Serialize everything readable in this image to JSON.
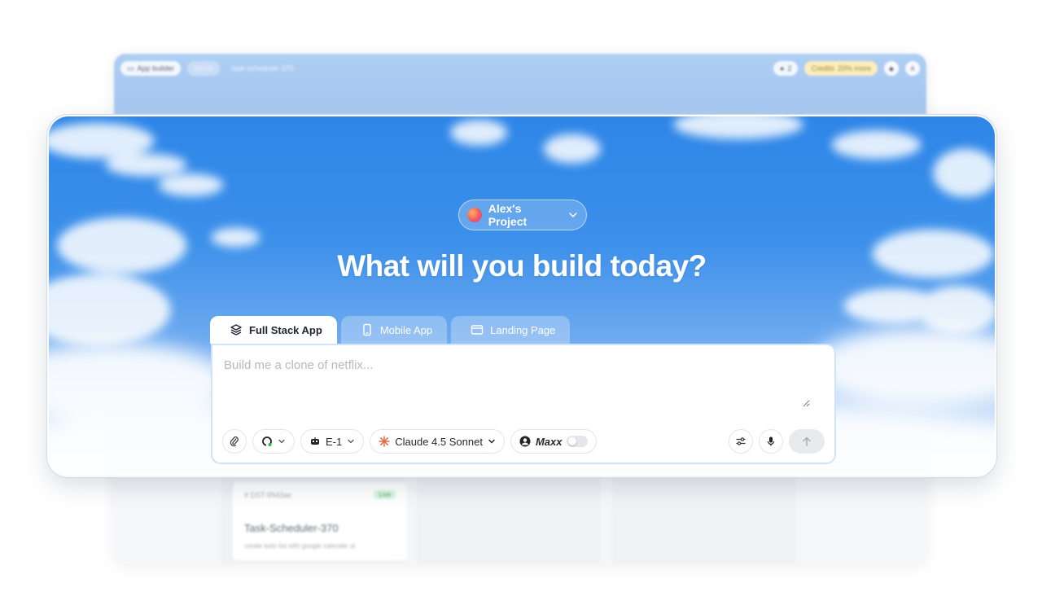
{
  "background_window": {
    "app_builder_label": "App builder",
    "home_label": "Home",
    "crumb": "task-scheduler-370",
    "count": "2",
    "credits_label": "Credits",
    "credits_badge": "20% more",
    "avatar": "A",
    "card": {
      "id": "# DST-9943ae",
      "status": "Live",
      "title": "Task-Scheduler-370",
      "description": "create todo list with google calendar ui"
    }
  },
  "project": {
    "name": "Alex's Project"
  },
  "headline": "What will you build today?",
  "tabs": [
    {
      "label": "Full Stack App",
      "icon": "layers-icon",
      "active": true
    },
    {
      "label": "Mobile App",
      "icon": "mobile-icon",
      "active": false
    },
    {
      "label": "Landing Page",
      "icon": "browser-window-icon",
      "active": false
    }
  ],
  "composer": {
    "placeholder": "Build me a clone of netflix...",
    "value": ""
  },
  "toolbar": {
    "agent_label": "E-1",
    "model_label": "Claude 4.5 Sonnet",
    "maxx_label": "Maxx",
    "maxx_enabled": false
  },
  "colors": {
    "accent_sky": "#3c90ea",
    "composer_border": "#cfe3fb",
    "model_icon": "#e36c4e"
  }
}
